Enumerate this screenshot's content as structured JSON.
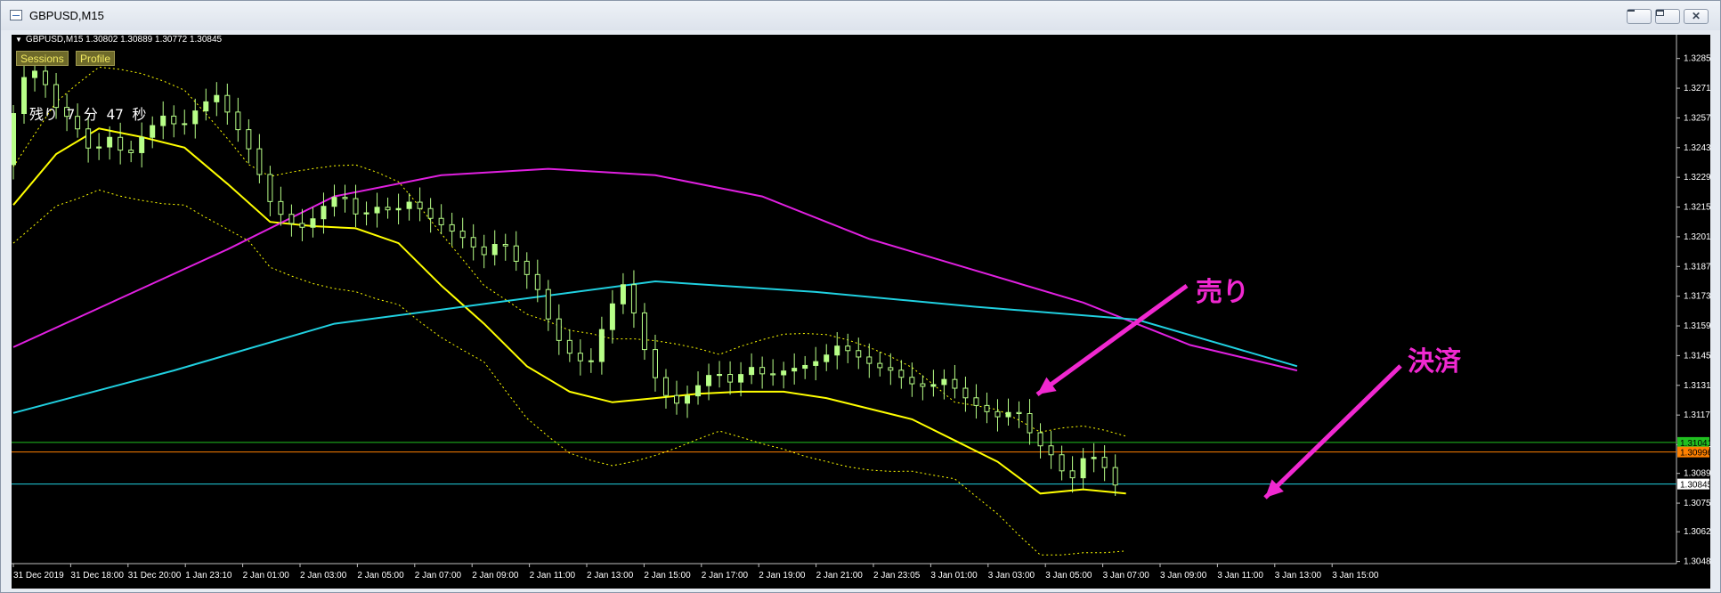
{
  "window": {
    "title": "GBPUSD,M15"
  },
  "chart": {
    "symbol_info": "GBPUSD,M15  1.30802 1.30889 1.30772 1.30845",
    "buttons": [
      {
        "label": "Sessions"
      },
      {
        "label": "Profile"
      }
    ],
    "timer_text": "残り 7 分 47 秒",
    "annotations": {
      "sell": "売り",
      "settle": "決済"
    },
    "colors": {
      "background": "#000000",
      "bull": "#b8ff88",
      "bear": "#b8ff88",
      "ma_fast": "#ffff00",
      "ma_mid": "#e020e0",
      "ma_slow": "#20d0e0",
      "bands": "#ffff00",
      "annotation": "#f028d0",
      "level_green": "#20c020",
      "level_orange": "#ff8000",
      "level_cyan": "#20d0e0"
    }
  },
  "chart_data": {
    "type": "candlestick",
    "symbol": "GBPUSD",
    "timeframe": "M15",
    "ohlc_current": {
      "open": 1.30802,
      "high": 1.30889,
      "low": 1.30772,
      "close": 1.30845
    },
    "y_ticks": [
      "1.32850",
      "1.32710",
      "1.32570",
      "1.32430",
      "1.32290",
      "1.32150",
      "1.32010",
      "1.31870",
      "1.31730",
      "1.31590",
      "1.31450",
      "1.31310",
      "1.31170",
      "1.31030",
      "1.30895",
      "1.30755",
      "1.30620",
      "1.30480"
    ],
    "y_range": [
      1.3047,
      1.3292
    ],
    "price_labels": [
      {
        "value": "1.31041",
        "color": "#20c020"
      },
      {
        "value": "1.30996",
        "color": "#ff8000"
      },
      {
        "value": "1.30845",
        "color": "#ffffff"
      }
    ],
    "x_ticks": [
      "31 Dec 2019",
      "31 Dec 18:00",
      "31 Dec 20:00",
      "1 Jan 23:10",
      "2 Jan 01:00",
      "2 Jan 03:00",
      "2 Jan 05:00",
      "2 Jan 07:00",
      "2 Jan 09:00",
      "2 Jan 11:00",
      "2 Jan 13:00",
      "2 Jan 15:00",
      "2 Jan 17:00",
      "2 Jan 19:00",
      "2 Jan 21:00",
      "2 Jan 23:05",
      "3 Jan 01:00",
      "3 Jan 03:00",
      "3 Jan 05:00",
      "3 Jan 07:00",
      "3 Jan 09:00",
      "3 Jan 11:00",
      "3 Jan 13:00",
      "3 Jan 15:00"
    ],
    "close_path": [
      1.3235,
      1.3275,
      1.328,
      1.3262,
      1.3255,
      1.324,
      1.3248,
      1.3238,
      1.325,
      1.3258,
      1.3252,
      1.3262,
      1.3268,
      1.3255,
      1.324,
      1.3218,
      1.3208,
      1.3205,
      1.3215,
      1.3222,
      1.321,
      1.3215,
      1.3213,
      1.3218,
      1.321,
      1.3205,
      1.32,
      1.3192,
      1.32,
      1.3188,
      1.3178,
      1.3155,
      1.3145,
      1.314,
      1.3165,
      1.318,
      1.315,
      1.3128,
      1.3122,
      1.313,
      1.3138,
      1.3132,
      1.314,
      1.3135,
      1.3138,
      1.314,
      1.3143,
      1.315,
      1.3145,
      1.314,
      1.3138,
      1.3132,
      1.313,
      1.3134,
      1.3126,
      1.312,
      1.3116,
      1.312,
      1.3105,
      1.3098,
      1.3085,
      1.31,
      1.3092,
      1.3078,
      1.307,
      1.3072,
      1.3066,
      1.3058,
      1.3064,
      1.308,
      1.3092,
      1.3085,
      1.3078,
      1.3074,
      1.3082
    ],
    "moving_averages": [
      {
        "color": "#ffff00",
        "points": [
          [
            0,
            1.3216
          ],
          [
            4,
            1.324
          ],
          [
            8,
            1.3252
          ],
          [
            12,
            1.3248
          ],
          [
            16,
            1.3243
          ],
          [
            20,
            1.3226
          ],
          [
            24,
            1.3208
          ],
          [
            28,
            1.3206
          ],
          [
            32,
            1.3205
          ],
          [
            36,
            1.3198
          ],
          [
            40,
            1.3178
          ],
          [
            44,
            1.316
          ],
          [
            48,
            1.314
          ],
          [
            52,
            1.3128
          ],
          [
            56,
            1.3123
          ],
          [
            60,
            1.3125
          ],
          [
            64,
            1.3127
          ],
          [
            68,
            1.3128
          ],
          [
            72,
            1.3128
          ],
          [
            76,
            1.3125
          ],
          [
            80,
            1.312
          ],
          [
            84,
            1.3115
          ],
          [
            88,
            1.3105
          ],
          [
            92,
            1.3095
          ],
          [
            96,
            1.308
          ],
          [
            100,
            1.3082
          ],
          [
            104,
            1.308
          ]
        ]
      },
      {
        "color": "#e020e0",
        "points": [
          [
            0,
            1.3149
          ],
          [
            10,
            1.3172
          ],
          [
            20,
            1.3195
          ],
          [
            30,
            1.322
          ],
          [
            40,
            1.323
          ],
          [
            50,
            1.3233
          ],
          [
            60,
            1.323
          ],
          [
            70,
            1.322
          ],
          [
            80,
            1.32
          ],
          [
            90,
            1.3185
          ],
          [
            100,
            1.317
          ],
          [
            110,
            1.315
          ],
          [
            120,
            1.3138
          ]
        ]
      },
      {
        "color": "#20d0e0",
        "points": [
          [
            0,
            1.3118
          ],
          [
            15,
            1.3138
          ],
          [
            30,
            1.316
          ],
          [
            45,
            1.317
          ],
          [
            60,
            1.318
          ],
          [
            75,
            1.3175
          ],
          [
            90,
            1.3168
          ],
          [
            105,
            1.3162
          ],
          [
            120,
            1.314
          ]
        ]
      }
    ]
  }
}
